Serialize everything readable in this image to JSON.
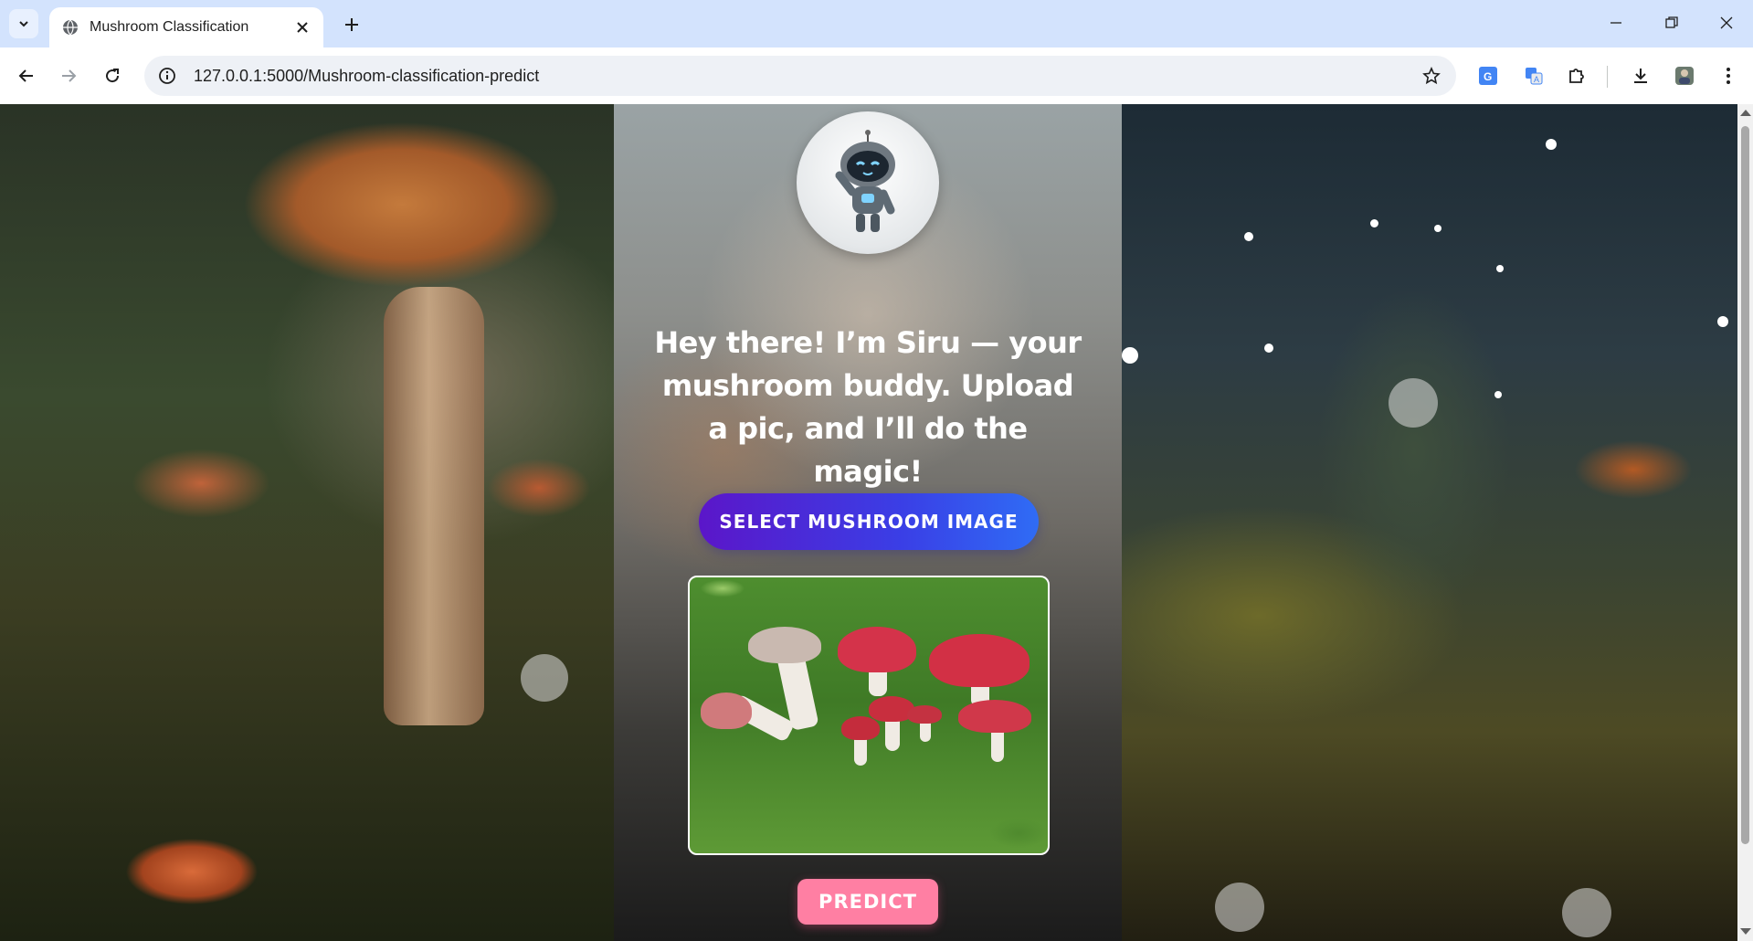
{
  "browser": {
    "tab_title": "Mushroom Classification",
    "url": "127.0.0.1:5000/Mushroom-classification-predict"
  },
  "page": {
    "headline": "Hey there! I’m Siru — your mushroom buddy. Upload a pic, and I’ll do the magic!",
    "select_button": "SELECT MUSHROOM IMAGE",
    "predict_button": "PREDICT"
  },
  "icons": {
    "tab_search": "chevron-down-icon",
    "favicon": "globe-icon",
    "tab_close": "close-icon",
    "new_tab": "plus-icon",
    "back": "arrow-left-icon",
    "forward": "arrow-right-icon",
    "reload": "reload-icon",
    "site_info": "info-icon",
    "bookmark": "star-icon",
    "google_translate": "google-translate-icon",
    "translate": "translate-icon",
    "extensions": "puzzle-icon",
    "downloads": "download-icon",
    "profile": "profile-avatar-icon",
    "menu": "kebab-menu-icon",
    "mascot": "robot-mascot-icon"
  },
  "colors": {
    "tabbar_bg": "#d3e3fd",
    "select_button_gradient_start": "#5b16c9",
    "select_button_gradient_end": "#2f6cf5",
    "predict_button": "#ff7fa3"
  }
}
